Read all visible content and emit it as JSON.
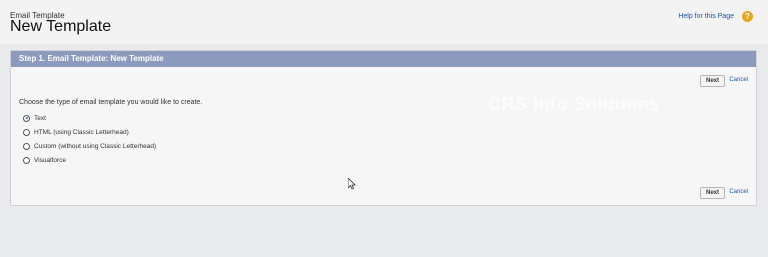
{
  "header": {
    "breadcrumb": "Email Template",
    "title": "New Template",
    "help_link": "Help for this Page",
    "help_icon": "?"
  },
  "panel": {
    "title": "Step 1. Email Template: New Template",
    "instruction": "Choose the type of email template you would like to create.",
    "options": [
      {
        "label": "Text",
        "selected": true
      },
      {
        "label": "HTML (using Classic Letterhead)",
        "selected": false
      },
      {
        "label": "Custom (without using Classic Letterhead)",
        "selected": false
      },
      {
        "label": "Visualforce",
        "selected": false
      }
    ],
    "next_label": "Next",
    "cancel_label": "Cancel"
  },
  "watermark": "CRS Info Solutions",
  "colors": {
    "panel_header": "#8c9bbd",
    "link": "#1a56a8",
    "help_icon": "#e3a81d"
  }
}
